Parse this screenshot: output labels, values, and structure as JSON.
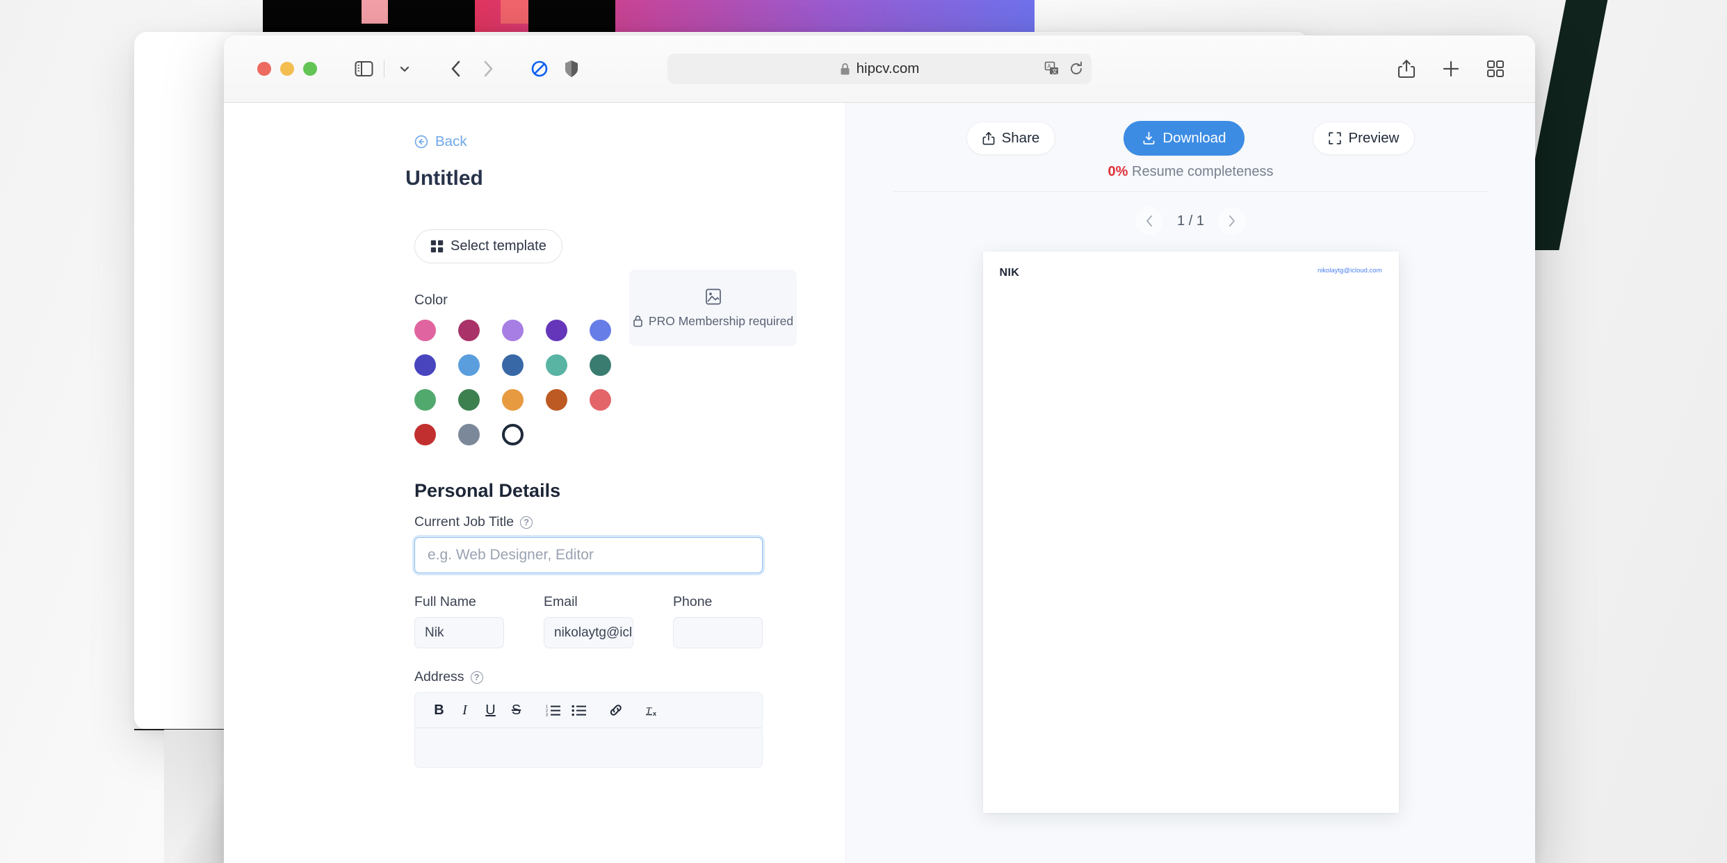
{
  "browser": {
    "url": "hipcv.com",
    "lock_icon": "lock-icon",
    "sidebar_icon": "sidebar-toggle-icon",
    "sidebar_chevron": "chevron-down-icon",
    "back_icon": "browser-back-icon",
    "forward_icon": "browser-forward-icon",
    "blocked_icon": "content-blocker-icon",
    "shield_icon": "privacy-shield-icon",
    "translate_icon": "translate-icon",
    "reload_icon": "reload-icon",
    "share_icon": "share-icon",
    "newtab_icon": "plus-icon",
    "tabs_icon": "tab-overview-icon"
  },
  "editor": {
    "back_label": "Back",
    "document_title": "Untitled",
    "select_template_label": "Select template",
    "pro_box": {
      "image_icon": "image-placeholder-icon",
      "lock_icon": "lock-icon",
      "label": "PRO Membership required"
    },
    "color_label": "Color",
    "colors": [
      {
        "name": "pink",
        "hex": "#e0649f",
        "selected": false
      },
      {
        "name": "magenta",
        "hex": "#a93368",
        "selected": false
      },
      {
        "name": "light-purple",
        "hex": "#a77ee4",
        "selected": false
      },
      {
        "name": "purple",
        "hex": "#6536b9",
        "selected": false
      },
      {
        "name": "periwinkle",
        "hex": "#667de8",
        "selected": false
      },
      {
        "name": "indigo",
        "hex": "#4845bf",
        "selected": false
      },
      {
        "name": "light-blue",
        "hex": "#5a9ede",
        "selected": false
      },
      {
        "name": "steel-blue",
        "hex": "#3869a6",
        "selected": false
      },
      {
        "name": "teal",
        "hex": "#59b4a4",
        "selected": false
      },
      {
        "name": "dark-teal",
        "hex": "#3b7c71",
        "selected": false
      },
      {
        "name": "light-green",
        "hex": "#52a96e",
        "selected": false
      },
      {
        "name": "green",
        "hex": "#3d8050",
        "selected": false
      },
      {
        "name": "orange",
        "hex": "#e79a3f",
        "selected": false
      },
      {
        "name": "burnt-orange",
        "hex": "#bd5a23",
        "selected": false
      },
      {
        "name": "salmon",
        "hex": "#e3656a",
        "selected": false
      },
      {
        "name": "red",
        "hex": "#c22f2f",
        "selected": false
      },
      {
        "name": "slate-gray",
        "hex": "#7b8899",
        "selected": false
      },
      {
        "name": "white",
        "hex": "#ffffff",
        "selected": true
      }
    ],
    "personal_details": {
      "section_title": "Personal Details",
      "job_title": {
        "label": "Current Job Title",
        "help_icon": "help-circle-icon",
        "placeholder": "e.g. Web Designer, Editor",
        "value": ""
      },
      "full_name": {
        "label": "Full Name",
        "value": "Nik"
      },
      "email": {
        "label": "Email",
        "value": "nikolaytg@icl"
      },
      "phone": {
        "label": "Phone",
        "value": ""
      },
      "address": {
        "label": "Address",
        "help_icon": "help-circle-icon",
        "toolbar": [
          {
            "name": "bold-icon",
            "glyph": "B"
          },
          {
            "name": "italic-icon",
            "glyph": "I"
          },
          {
            "name": "underline-icon",
            "glyph": "U"
          },
          {
            "name": "strikethrough-icon",
            "glyph": "S"
          },
          {
            "name": "ordered-list-icon",
            "glyph": ""
          },
          {
            "name": "unordered-list-icon",
            "glyph": ""
          },
          {
            "name": "link-icon",
            "glyph": ""
          },
          {
            "name": "clear-formatting-icon",
            "glyph": ""
          }
        ],
        "value": ""
      }
    }
  },
  "preview": {
    "share_label": "Share",
    "download_label": "Download",
    "preview_label": "Preview",
    "share_icon": "share-icon",
    "download_icon": "download-icon",
    "preview_icon": "expand-icon",
    "completeness_percent": "0%",
    "completeness_label": "Resume completeness",
    "prev_icon": "chevron-left-icon",
    "next_icon": "chevron-right-icon",
    "page_indicator": "1 / 1",
    "resume": {
      "name": "NIK",
      "email": "nikolaytg@icloud.com"
    }
  },
  "accents": {
    "primary_blue": "#3c8ce4",
    "link_blue": "#6fa8e8",
    "danger_red": "#e0303a",
    "title_navy": "#1d2637"
  }
}
